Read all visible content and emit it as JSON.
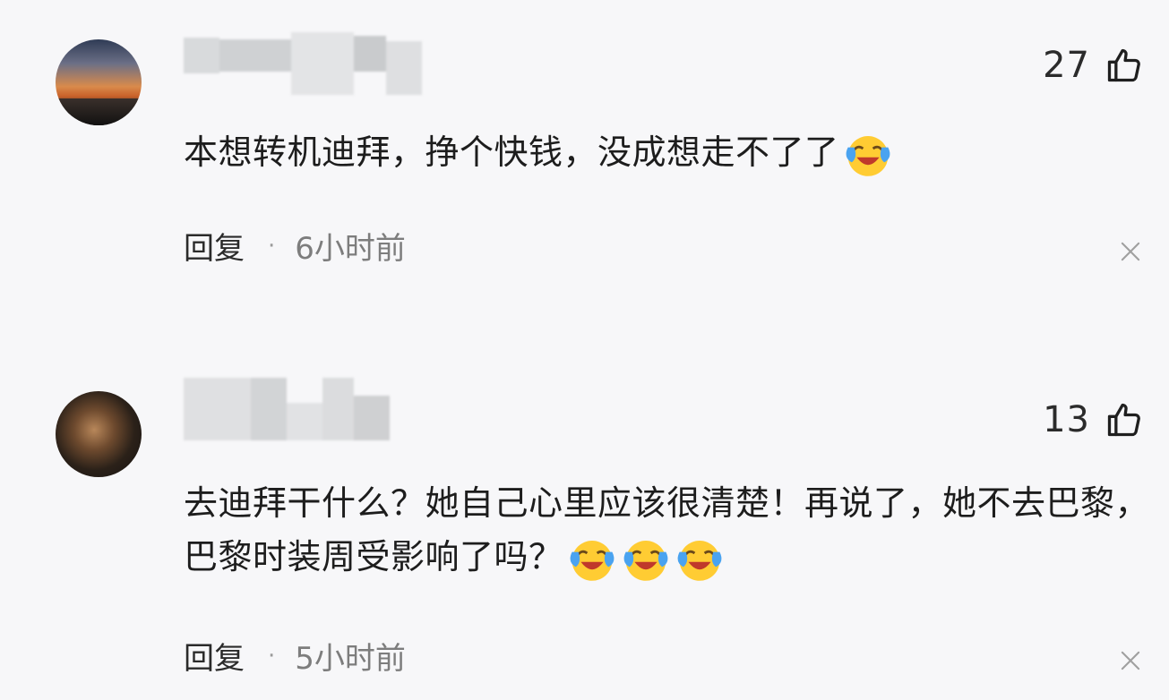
{
  "comments": [
    {
      "avatar": "sunset-avatar",
      "likes": "27",
      "text": "本想转机迪拜，挣个快钱，没成想走不了了",
      "emoji_count": 1,
      "reply_label": "回复",
      "separator": "·",
      "time": "6小时前"
    },
    {
      "avatar": "tiger-avatar",
      "likes": "13",
      "text": "去迪拜干什么？她自己心里应该很清楚！再说了，她不去巴黎，巴黎时装周受影响了吗？",
      "emoji_count": 3,
      "reply_label": "回复",
      "separator": "·",
      "time": "5小时前"
    }
  ],
  "icons": {
    "like": "thumbs-up-icon",
    "close": "close-icon",
    "emoji": "laughing-crying-emoji"
  },
  "colors": {
    "background": "#f7f7f9",
    "text": "#1d1d1d",
    "muted": "#7d7d7d",
    "emoji_face": "#ffcc33",
    "emoji_tear": "#4aa3f0"
  }
}
